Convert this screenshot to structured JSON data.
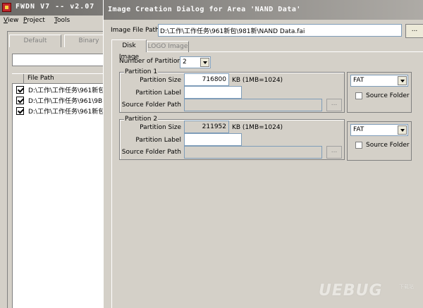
{
  "main_window": {
    "title": "FWDN V7 -- v2.07",
    "menu": [
      "View",
      "Project",
      "Tools"
    ],
    "tabs": [
      "Default",
      "Binary"
    ],
    "list_header": "File Path",
    "files": [
      "D:\\工作\\工作任务\\961新包",
      "D:\\工作\\工作任务\\961\\9B",
      "D:\\工作\\工作任务\\961新包"
    ]
  },
  "dialog": {
    "title": "Image Creation Dialog for Area 'NAND Data'",
    "image_path_label": "Image File Path:",
    "image_path_value": "D:\\工作\\工作任务\\961新包\\981新\\NAND Data.fai",
    "browse_label": "...",
    "tabs": [
      "Disk Image",
      "LOGO Image"
    ],
    "num_partition_label": "Number of Partition",
    "num_partition_value": "2",
    "partitions": [
      {
        "title": "Partition 1",
        "size_label": "Partition Size",
        "size_value": "716800",
        "unit": "KB (1MB=1024)",
        "label_label": "Partition Label",
        "label_value": "",
        "source_label": "Source Folder Path",
        "browse_label": "...",
        "filesystem": "FAT",
        "source_folder_checkbox": "Source Folder"
      },
      {
        "title": "Partition 2",
        "size_label": "Partition Size",
        "size_value": "211952",
        "unit": "KB (1MB=1024)",
        "label_label": "Partition Label",
        "label_value": "",
        "source_label": "Source Folder Path",
        "browse_label": "...",
        "filesystem": "FAT",
        "source_folder_checkbox": "Source Folder"
      }
    ]
  },
  "watermark": {
    "brand": "UEBUG",
    "sub": "下载站"
  }
}
